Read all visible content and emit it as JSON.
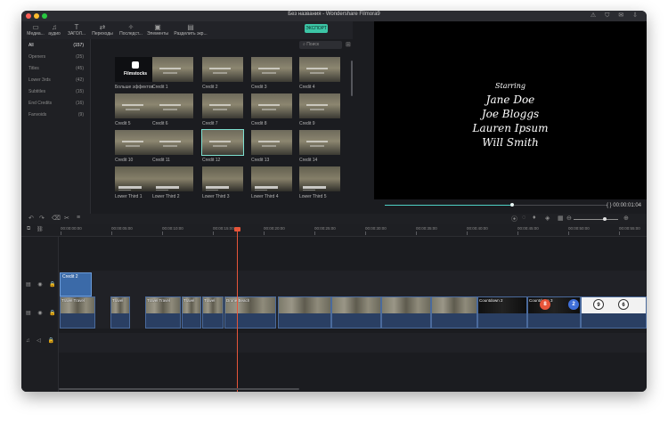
{
  "window": {
    "title": "Без названия - Wondershare Filmora9",
    "traffic_lights": [
      "#ff5f57",
      "#febc2e",
      "#28c840"
    ],
    "right_icons": "⚠ ⛉ ✉ ⇩"
  },
  "toolbar": {
    "items": [
      {
        "label": "Медиа...",
        "icon": "folder-icon"
      },
      {
        "label": "аудио",
        "icon": "music-note-icon"
      },
      {
        "label": "ЗАГОЛ...",
        "icon": "text-icon"
      },
      {
        "label": "Переходы",
        "icon": "transition-icon"
      },
      {
        "label": "Последст...",
        "icon": "effects-icon"
      },
      {
        "label": "Элементы",
        "icon": "elements-icon"
      },
      {
        "label": "Разделить экр...",
        "icon": "split-screen-icon"
      }
    ],
    "export_label": "ЭКСПОРТ"
  },
  "sidebar": {
    "items": [
      {
        "label": "All",
        "count": "(157)"
      },
      {
        "label": "Openers",
        "count": "(25)"
      },
      {
        "label": "Titles",
        "count": "(45)"
      },
      {
        "label": "Lower 3rds",
        "count": "(42)"
      },
      {
        "label": "Subtitles",
        "count": "(15)"
      },
      {
        "label": "End Credits",
        "count": "(16)"
      },
      {
        "label": "Fanvoids",
        "count": "(9)"
      }
    ]
  },
  "search": {
    "placeholder": "Поиск"
  },
  "library": {
    "items": [
      {
        "label": "Больше эффектов",
        "kind": "filmstocks"
      },
      {
        "label": "Credit 1"
      },
      {
        "label": "Credit 2"
      },
      {
        "label": "Credit 3"
      },
      {
        "label": "Credit 4"
      },
      {
        "label": "Credit 5"
      },
      {
        "label": "Credit 6"
      },
      {
        "label": "Credit 7"
      },
      {
        "label": "Credit 8"
      },
      {
        "label": "Credit 9"
      },
      {
        "label": "Credit 10"
      },
      {
        "label": "Credit 11"
      },
      {
        "label": "Credit 12",
        "selected": true
      },
      {
        "label": "Credit 13"
      },
      {
        "label": "Credit 14"
      },
      {
        "label": "Lower Third 1",
        "kind": "lower"
      },
      {
        "label": "Lower Third 2",
        "kind": "lower"
      },
      {
        "label": "Lower Third 3",
        "kind": "lower"
      },
      {
        "label": "Lower Third 4",
        "kind": "lower"
      },
      {
        "label": "Lower Third 5",
        "kind": "lower"
      }
    ],
    "filmstocks_brand": "Filmstocks"
  },
  "preview": {
    "starring": "Starring",
    "names": [
      "Jane Doe",
      "Joe Bloggs",
      "Lauren Ipsum",
      "Will Smith"
    ]
  },
  "transport": {
    "timecode": "{  }  00:00:01:04",
    "progress": 0.57,
    "buttons": [
      "⏮",
      "▶",
      "⏸",
      "■"
    ]
  },
  "ruler": {
    "ticks": [
      "00:00:00:00",
      "00:00:05:00",
      "00:00:10:00",
      "00:00:15:00",
      "00:00:20:00",
      "00:00:25:00",
      "00:00:30:00",
      "00:00:35:00",
      "00:00:40:00",
      "00:00:45:00",
      "00:00:50:00",
      "00:00:55:00",
      "00:00:60:00"
    ]
  },
  "timeline": {
    "title_clip": "Credit 2",
    "video_clips": [
      {
        "label": "Travel Travel"
      },
      {
        "label": "Travel"
      },
      {
        "label": "Travel Travel"
      },
      {
        "label": "Travel"
      },
      {
        "label": "Travel"
      },
      {
        "label": "Drone Beach"
      },
      {
        "label": ""
      },
      {
        "label": ""
      },
      {
        "label": ""
      },
      {
        "label": ""
      },
      {
        "label": "Countdown 2"
      },
      {
        "label": "Countdown 3"
      },
      {
        "label": ""
      }
    ],
    "countdown_numbers": [
      "8",
      "2",
      "9",
      "6"
    ],
    "zoom_level": 0.66
  }
}
